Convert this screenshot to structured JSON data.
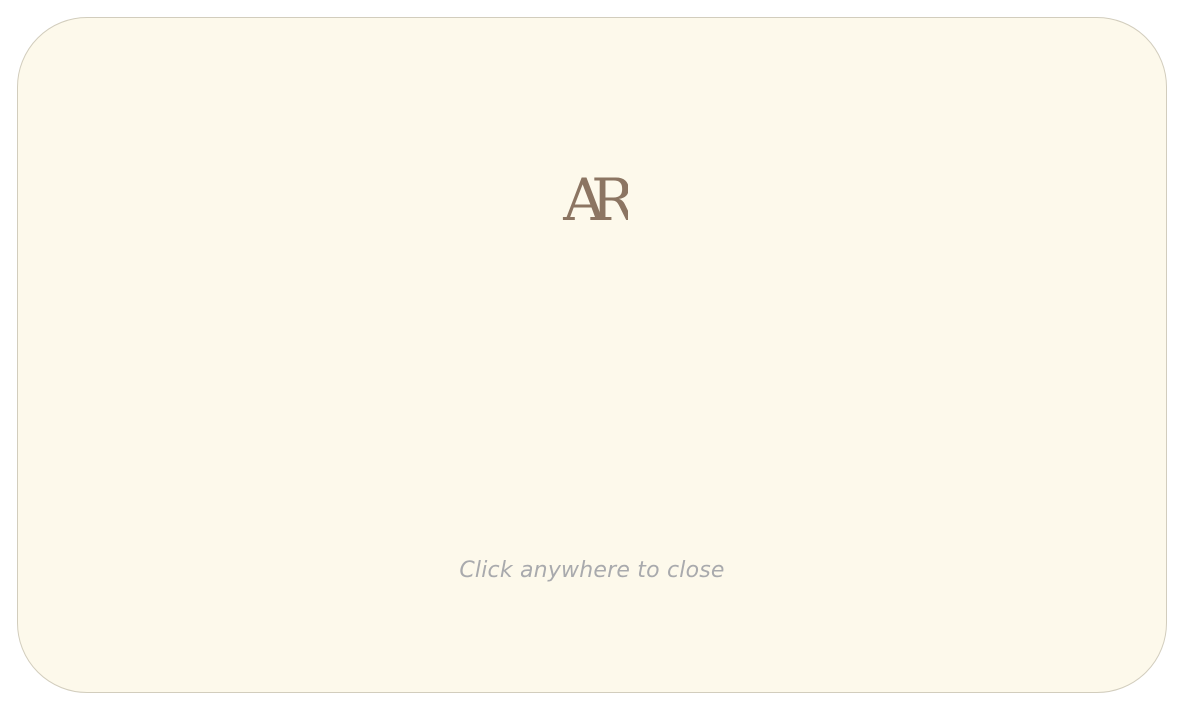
{
  "overlay": {
    "logo_text": "AR",
    "hint": "Click anywhere to close"
  },
  "colors": {
    "panel_background": "#fdf9eb",
    "panel_border": "#d2cdbd",
    "logo": "#8c7562",
    "hint": "#a9aaad"
  }
}
